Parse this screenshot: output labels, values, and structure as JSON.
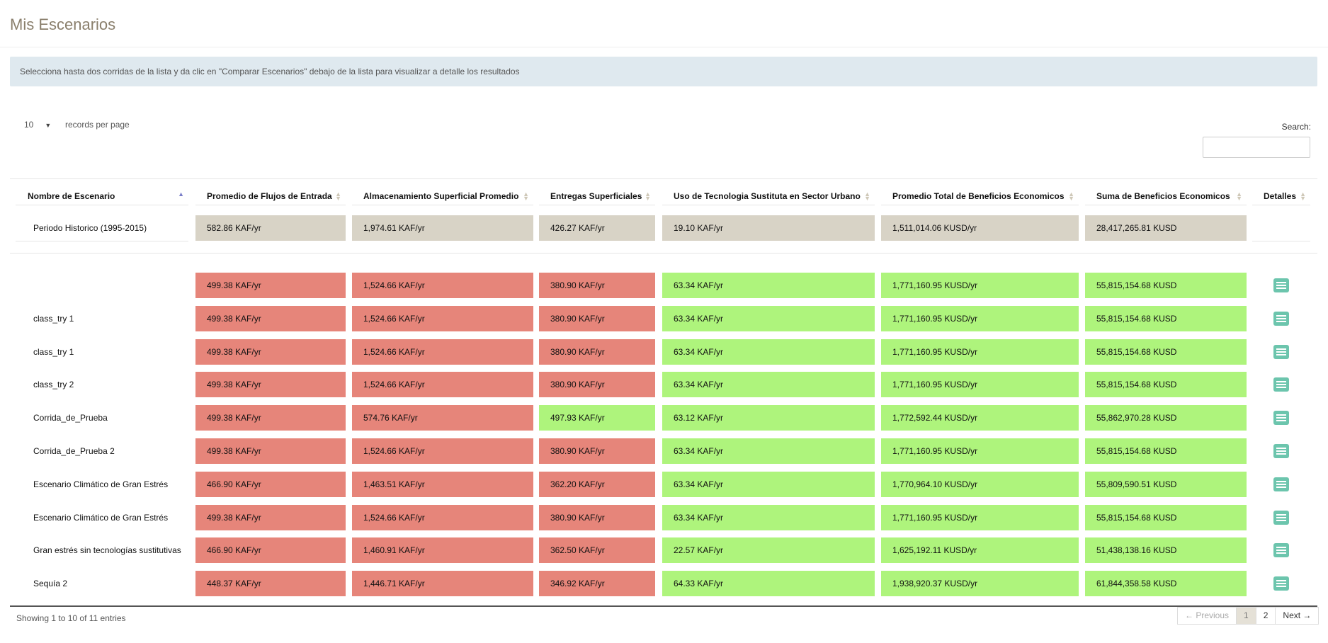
{
  "page": {
    "title": "Mis Escenarios"
  },
  "alert": {
    "text": "Selecciona hasta dos corridas de la lista y da clic en \"Comparar Escenarios\" debajo de la lista para visualizar a detalle los resultados"
  },
  "controls": {
    "length_value": "10",
    "length_label": "records per page",
    "search_label": "Search:",
    "search_value": ""
  },
  "table": {
    "columns": [
      "Nombre de Escenario",
      "Promedio de Flujos de Entrada",
      "Almacenamiento Superficial Promedio",
      "Entregas Superficiales",
      "Uso de Tecnologia Sustituta en Sector Urbano",
      "Promedio Total de Beneficios Economicos",
      "Suma de Beneficios Economicos",
      "Detalles"
    ],
    "sorted_column": 0,
    "historic": {
      "name": "Periodo Historico (1995-2015)",
      "values": [
        "582.86 KAF/yr",
        "1,974.61 KAF/yr",
        "426.27 KAF/yr",
        "19.10 KAF/yr",
        "1,511,014.06 KUSD/yr",
        "28,417,265.81 KUSD"
      ]
    },
    "rows": [
      {
        "name": "",
        "values": [
          "499.38 KAF/yr",
          "1,524.66 KAF/yr",
          "380.90 KAF/yr",
          "63.34 KAF/yr",
          "1,771,160.95 KUSD/yr",
          "55,815,154.68 KUSD"
        ],
        "status": [
          "red",
          "red",
          "red",
          "green",
          "green",
          "green"
        ]
      },
      {
        "name": "class_try 1",
        "values": [
          "499.38 KAF/yr",
          "1,524.66 KAF/yr",
          "380.90 KAF/yr",
          "63.34 KAF/yr",
          "1,771,160.95 KUSD/yr",
          "55,815,154.68 KUSD"
        ],
        "status": [
          "red",
          "red",
          "red",
          "green",
          "green",
          "green"
        ]
      },
      {
        "name": "class_try 1",
        "values": [
          "499.38 KAF/yr",
          "1,524.66 KAF/yr",
          "380.90 KAF/yr",
          "63.34 KAF/yr",
          "1,771,160.95 KUSD/yr",
          "55,815,154.68 KUSD"
        ],
        "status": [
          "red",
          "red",
          "red",
          "green",
          "green",
          "green"
        ]
      },
      {
        "name": "class_try 2",
        "values": [
          "499.38 KAF/yr",
          "1,524.66 KAF/yr",
          "380.90 KAF/yr",
          "63.34 KAF/yr",
          "1,771,160.95 KUSD/yr",
          "55,815,154.68 KUSD"
        ],
        "status": [
          "red",
          "red",
          "red",
          "green",
          "green",
          "green"
        ]
      },
      {
        "name": "Corrida_de_Prueba",
        "values": [
          "499.38 KAF/yr",
          "574.76 KAF/yr",
          "497.93 KAF/yr",
          "63.12 KAF/yr",
          "1,772,592.44 KUSD/yr",
          "55,862,970.28 KUSD"
        ],
        "status": [
          "red",
          "red",
          "green",
          "green",
          "green",
          "green"
        ]
      },
      {
        "name": "Corrida_de_Prueba 2",
        "values": [
          "499.38 KAF/yr",
          "1,524.66 KAF/yr",
          "380.90 KAF/yr",
          "63.34 KAF/yr",
          "1,771,160.95 KUSD/yr",
          "55,815,154.68 KUSD"
        ],
        "status": [
          "red",
          "red",
          "red",
          "green",
          "green",
          "green"
        ]
      },
      {
        "name": "Escenario Climático de Gran Estrés",
        "values": [
          "466.90 KAF/yr",
          "1,463.51 KAF/yr",
          "362.20 KAF/yr",
          "63.34 KAF/yr",
          "1,770,964.10 KUSD/yr",
          "55,809,590.51 KUSD"
        ],
        "status": [
          "red",
          "red",
          "red",
          "green",
          "green",
          "green"
        ]
      },
      {
        "name": "Escenario Climático de Gran Estrés",
        "values": [
          "499.38 KAF/yr",
          "1,524.66 KAF/yr",
          "380.90 KAF/yr",
          "63.34 KAF/yr",
          "1,771,160.95 KUSD/yr",
          "55,815,154.68 KUSD"
        ],
        "status": [
          "red",
          "red",
          "red",
          "green",
          "green",
          "green"
        ]
      },
      {
        "name": "Gran estrés sin tecnologías sustitutivas",
        "values": [
          "466.90 KAF/yr",
          "1,460.91 KAF/yr",
          "362.50 KAF/yr",
          "22.57 KAF/yr",
          "1,625,192.11 KUSD/yr",
          "51,438,138.16 KUSD"
        ],
        "status": [
          "red",
          "red",
          "red",
          "green",
          "green",
          "green"
        ]
      },
      {
        "name": "Sequía 2",
        "values": [
          "448.37 KAF/yr",
          "1,446.71 KAF/yr",
          "346.92 KAF/yr",
          "64.33 KAF/yr",
          "1,938,920.37 KUSD/yr",
          "61,844,358.58 KUSD"
        ],
        "status": [
          "red",
          "red",
          "red",
          "green",
          "green",
          "green"
        ]
      }
    ]
  },
  "footer": {
    "info": "Showing 1 to 10 of 11 entries",
    "prev": "← Previous",
    "pages": [
      "1",
      "2"
    ],
    "current_page": "1",
    "next": "Next →"
  },
  "colors": {
    "red": "#e6857a",
    "green": "#aef47c",
    "historic": "#d8d3c6",
    "details_button": "#6cc5ad"
  },
  "icons": {
    "details": "list-icon"
  }
}
